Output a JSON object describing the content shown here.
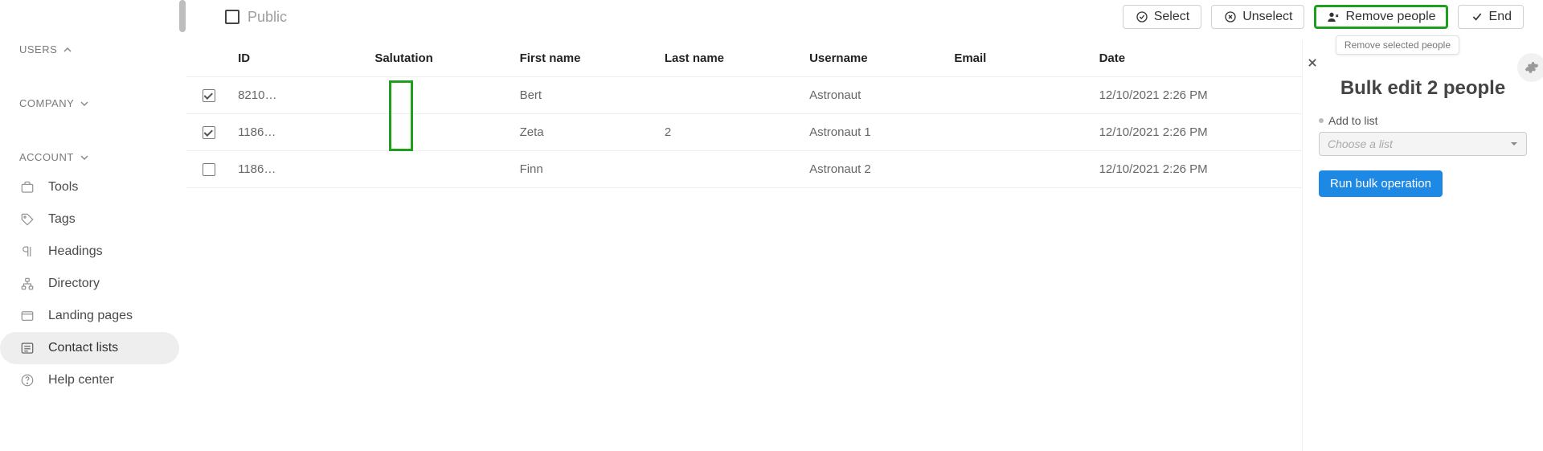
{
  "sidebar": {
    "sections": [
      {
        "label": "USERS",
        "open": true
      },
      {
        "label": "COMPANY",
        "open": false
      },
      {
        "label": "ACCOUNT",
        "open": false
      }
    ],
    "items": [
      {
        "label": "Tools"
      },
      {
        "label": "Tags"
      },
      {
        "label": "Headings"
      },
      {
        "label": "Directory"
      },
      {
        "label": "Landing pages"
      },
      {
        "label": "Contact lists"
      },
      {
        "label": "Help center"
      }
    ]
  },
  "toolbar": {
    "public_label": "Public",
    "select": "Select",
    "unselect": "Unselect",
    "remove": "Remove people",
    "end": "End",
    "tooltip": "Remove selected people"
  },
  "table": {
    "headers": {
      "id": "ID",
      "salutation": "Salutation",
      "first": "First name",
      "last": "Last name",
      "user": "Username",
      "email": "Email",
      "date": "Date"
    },
    "rows": [
      {
        "checked": true,
        "id": "8210…",
        "salutation": "",
        "first": "Bert",
        "last": "",
        "user": "Astronaut",
        "email": "",
        "date": "12/10/2021 2:26 PM"
      },
      {
        "checked": true,
        "id": "1186…",
        "salutation": "",
        "first": "Zeta",
        "last": "2",
        "user": "Astronaut 1",
        "email": "",
        "date": "12/10/2021 2:26 PM"
      },
      {
        "checked": false,
        "id": "1186…",
        "salutation": "",
        "first": "Finn",
        "last": "",
        "user": "Astronaut 2",
        "email": "",
        "date": "12/10/2021 2:26 PM"
      }
    ]
  },
  "panel": {
    "title": "Bulk edit 2 people",
    "add_to_list_label": "Add to list",
    "select_placeholder": "Choose a list",
    "run_label": "Run bulk operation"
  }
}
